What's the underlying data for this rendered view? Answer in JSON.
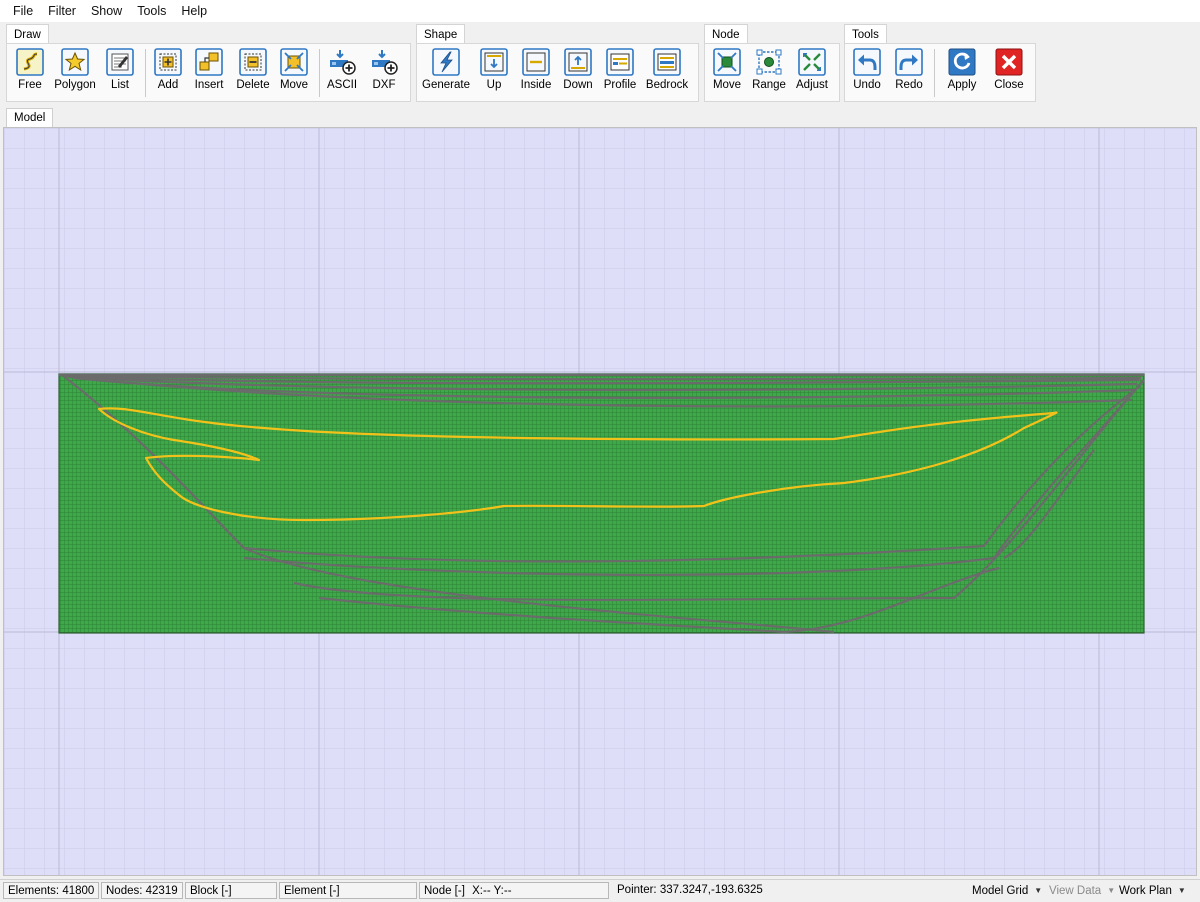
{
  "menu": [
    "File",
    "Filter",
    "Show",
    "Tools",
    "Help"
  ],
  "groups": {
    "draw": {
      "label": "Draw",
      "buttons": [
        {
          "label": "Free",
          "icon": "free-draw-icon"
        },
        {
          "label": "Polygon",
          "icon": "star-polygon-icon"
        },
        {
          "label": "List",
          "icon": "list-edit-icon"
        },
        {
          "label": "Add",
          "icon": "add-node-icon"
        },
        {
          "label": "Insert",
          "icon": "insert-node-icon"
        },
        {
          "label": "Delete",
          "icon": "delete-node-icon"
        },
        {
          "label": "Move",
          "icon": "move-node-icon"
        },
        {
          "label": "ASCII",
          "icon": "ascii-import-icon"
        },
        {
          "label": "DXF",
          "icon": "dxf-import-icon"
        }
      ]
    },
    "shape": {
      "label": "Shape",
      "buttons": [
        {
          "label": "Generate",
          "icon": "generate-icon"
        },
        {
          "label": "Up",
          "icon": "shape-up-icon"
        },
        {
          "label": "Inside",
          "icon": "shape-inside-icon"
        },
        {
          "label": "Down",
          "icon": "shape-down-icon"
        },
        {
          "label": "Profile",
          "icon": "profile-icon"
        },
        {
          "label": "Bedrock",
          "icon": "bedrock-icon"
        }
      ]
    },
    "node": {
      "label": "Node",
      "buttons": [
        {
          "label": "Move",
          "icon": "node-move-icon"
        },
        {
          "label": "Range",
          "icon": "node-range-icon"
        },
        {
          "label": "Adjust",
          "icon": "node-adjust-icon"
        }
      ]
    },
    "tools": {
      "label": "Tools",
      "buttons": [
        {
          "label": "Undo",
          "icon": "undo-icon"
        },
        {
          "label": "Redo",
          "icon": "redo-icon"
        },
        {
          "label": "Apply",
          "icon": "apply-refresh-icon"
        },
        {
          "label": "Close",
          "icon": "close-red-icon"
        }
      ]
    }
  },
  "view_tab": "Model",
  "status": {
    "elements": "Elements: 41800",
    "nodes": "Nodes: 42319",
    "block": "Block [-]",
    "element": "Element [-]",
    "node": "Node [-]",
    "xy": "X:-- Y:--",
    "pointer": "Pointer: 337.3247,-193.6325",
    "model_grid": "Model Grid",
    "view_data": "View Data",
    "work_plan": "Work Plan"
  },
  "colors": {
    "canvas_bg": "#dedef9",
    "mesh_fill": "#3ea84a",
    "mesh_line": "#2a7a2f",
    "boundary_line": "#6b6b6b",
    "highlight_line": "#f2c21b",
    "icon_blue": "#2f78c4"
  }
}
